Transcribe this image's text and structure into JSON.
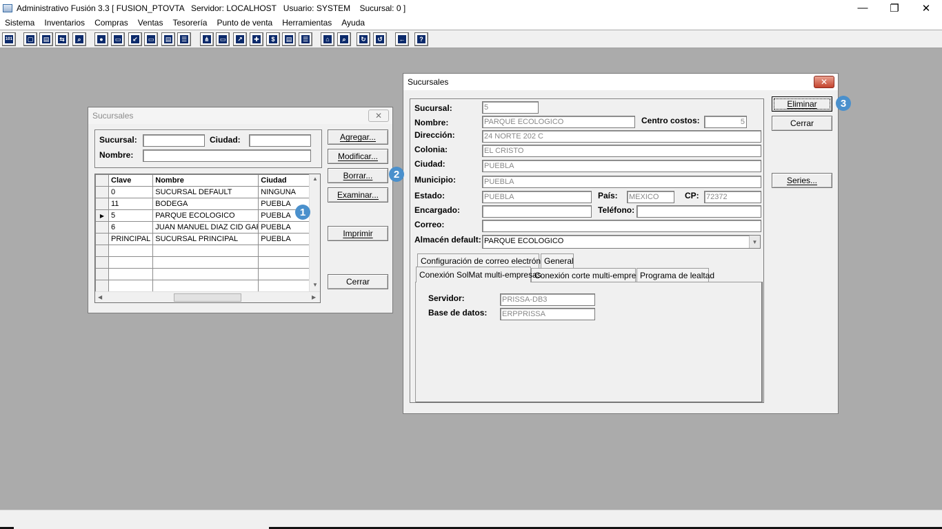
{
  "app": {
    "title": "Administrativo Fusión 3.3 [ FUSION_PTOVTA   Servidor: LOCALHOST   Usuario: SYSTEM    Sucursal: 0 ]",
    "minimize": "—",
    "restore": "❐",
    "close": "✕"
  },
  "menu": [
    "Sistema",
    "Inventarios",
    "Compras",
    "Ventas",
    "Tesorería",
    "Punto de venta",
    "Herramientas",
    "Ayuda"
  ],
  "toolbar_icons": [
    "calculator-icon",
    "copy-icon",
    "clipboard-icon",
    "transfer-icon",
    "zoom-icon",
    "user-icon",
    "folder-icon",
    "import-icon",
    "print-icon",
    "document-icon",
    "list-icon",
    "binoculars-icon",
    "window-icon",
    "export-icon",
    "add-icon",
    "dollar-icon",
    "report-icon",
    "table-icon",
    "home-icon",
    "search-icon",
    "refresh-icon",
    "undo-icon",
    "back-icon",
    "help-icon"
  ],
  "list_window": {
    "title": "Sucursales",
    "close": "✕",
    "filter": {
      "sucursal_label": "Sucursal:",
      "ciudad_label": "Ciudad:",
      "nombre_label": "Nombre:"
    },
    "columns": [
      "Clave",
      "Nombre",
      "Ciudad"
    ],
    "rows": [
      {
        "clave": "0",
        "nombre": "SUCURSAL DEFAULT",
        "ciudad": "NINGUNA",
        "current": false
      },
      {
        "clave": "11",
        "nombre": "BODEGA",
        "ciudad": "PUEBLA",
        "current": false
      },
      {
        "clave": "5",
        "nombre": "PARQUE ECOLOGICO",
        "ciudad": "PUEBLA",
        "current": true
      },
      {
        "clave": "6",
        "nombre": "JUAN MANUEL DIAZ CID GARC",
        "ciudad": "PUEBLA",
        "current": false
      },
      {
        "clave": "PRINCIPAL",
        "nombre": "SUCURSAL PRINCIPAL",
        "ciudad": "PUEBLA",
        "current": false
      }
    ],
    "empty_rows": 4,
    "row_pointer": "▶",
    "buttons": {
      "agregar": "Agregar...",
      "modificar": "Modificar...",
      "borrar": "Borrar...",
      "examinar": "Examinar...",
      "imprimir": "Imprimir",
      "cerrar": "Cerrar"
    }
  },
  "detail_window": {
    "title": "Sucursales",
    "close": "✕",
    "labels": {
      "sucursal": "Sucursal:",
      "nombre": "Nombre:",
      "centro_costos": "Centro  costos:",
      "direccion": "Dirección:",
      "colonia": "Colonia:",
      "ciudad": "Ciudad:",
      "municipio": "Municipio:",
      "estado": "Estado:",
      "pais": "País:",
      "cp": "CP:",
      "encargado": "Encargado:",
      "telefono": "Teléfono:",
      "correo": "Correo:",
      "almacen": "Almacén default:"
    },
    "values": {
      "sucursal": "5",
      "nombre": "PARQUE ECOLOGICO",
      "centro_costos": "5",
      "direccion": "24 NORTE 202 C",
      "colonia": "EL CRISTO",
      "ciudad": "PUEBLA",
      "municipio": "PUEBLA",
      "estado": "PUEBLA",
      "pais": "MEXICO",
      "cp": "72372",
      "encargado": "",
      "telefono": "",
      "correo": "",
      "almacen": "PARQUE ECOLOGICO"
    },
    "tabs_row1": [
      "Configuración de correo electrónico",
      "General"
    ],
    "tabs_row2": [
      "Conexión SolMat multi-empresas",
      "Conexión corte multi-empresas",
      "Programa de lealtad"
    ],
    "tab_panel": {
      "servidor_label": "Servidor:",
      "servidor_value": "PRISSA-DB3",
      "base_label": "Base de datos:",
      "base_value": "ERPPRISSA"
    },
    "buttons": {
      "eliminar": "Eliminar",
      "cerrar": "Cerrar",
      "series": "Series..."
    }
  },
  "badges": [
    "1",
    "2",
    "3"
  ],
  "colors": {
    "badge": "#4a90cc",
    "desktop": "#ababab",
    "toolbar_icon": "#0c2a6b"
  }
}
